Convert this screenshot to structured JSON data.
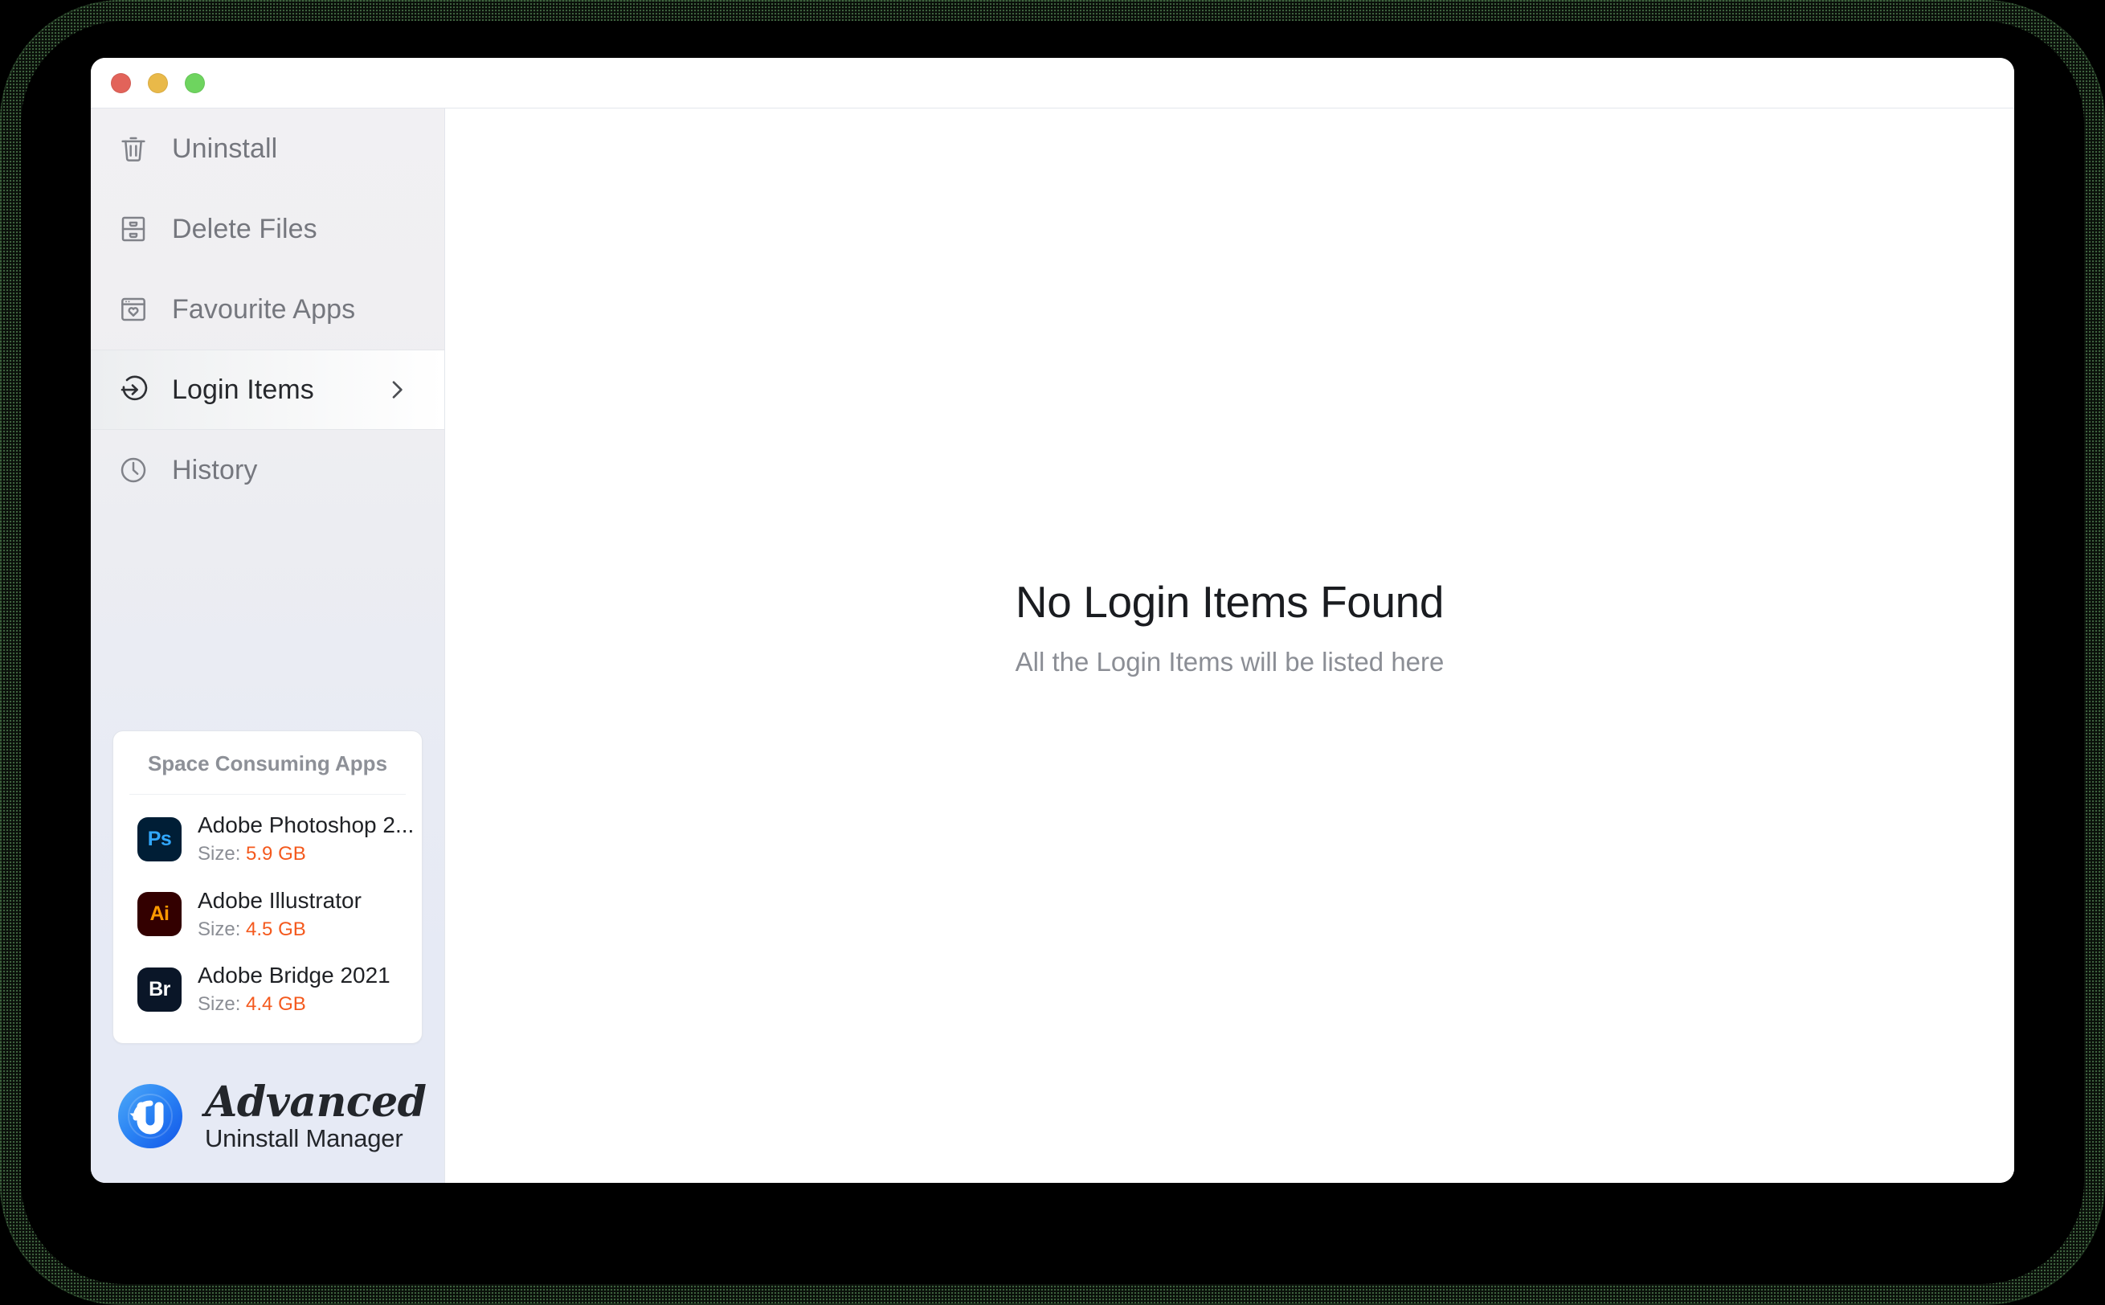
{
  "window": {
    "traffic_lights": [
      {
        "name": "close",
        "color": "#e2635a"
      },
      {
        "name": "minimize",
        "color": "#e9b949"
      },
      {
        "name": "zoom",
        "color": "#6ed45f"
      }
    ]
  },
  "sidebar": {
    "items": [
      {
        "label": "Uninstall",
        "icon": "trash-icon",
        "active": false,
        "has_chevron": false
      },
      {
        "label": "Delete Files",
        "icon": "file-cabinet-icon",
        "active": false,
        "has_chevron": false
      },
      {
        "label": "Favourite Apps",
        "icon": "window-heart-icon",
        "active": false,
        "has_chevron": false
      },
      {
        "label": "Login Items",
        "icon": "sign-in-icon",
        "active": true,
        "has_chevron": true
      },
      {
        "label": "History",
        "icon": "clock-icon",
        "active": false,
        "has_chevron": false
      }
    ],
    "space_card": {
      "title": "Space Consuming Apps",
      "size_label": "Size:",
      "apps": [
        {
          "name": "Adobe Photoshop 2...",
          "size": "5.9 GB",
          "icon_text": "Ps",
          "icon_bg": "#001e36",
          "icon_fg": "#31a8ff"
        },
        {
          "name": "Adobe Illustrator",
          "size": "4.5 GB",
          "icon_text": "Ai",
          "icon_bg": "#330000",
          "icon_fg": "#ff9a00"
        },
        {
          "name": "Adobe Bridge 2021",
          "size": "4.4 GB",
          "icon_text": "Br",
          "icon_bg": "#0a1628",
          "icon_fg": "#ffffff"
        }
      ]
    },
    "brand": {
      "title": "Advanced",
      "subtitle": "Uninstall Manager",
      "logo_icon": "advanced-uninstall-manager-logo"
    }
  },
  "main": {
    "empty_state": {
      "title": "No Login Items Found",
      "subtitle": "All the Login Items will be listed here"
    }
  },
  "colors": {
    "accent_orange": "#f4591d",
    "brand_blue": "#2e7bf6",
    "muted_text": "#8b8e95",
    "dark_text": "#1f2125"
  }
}
